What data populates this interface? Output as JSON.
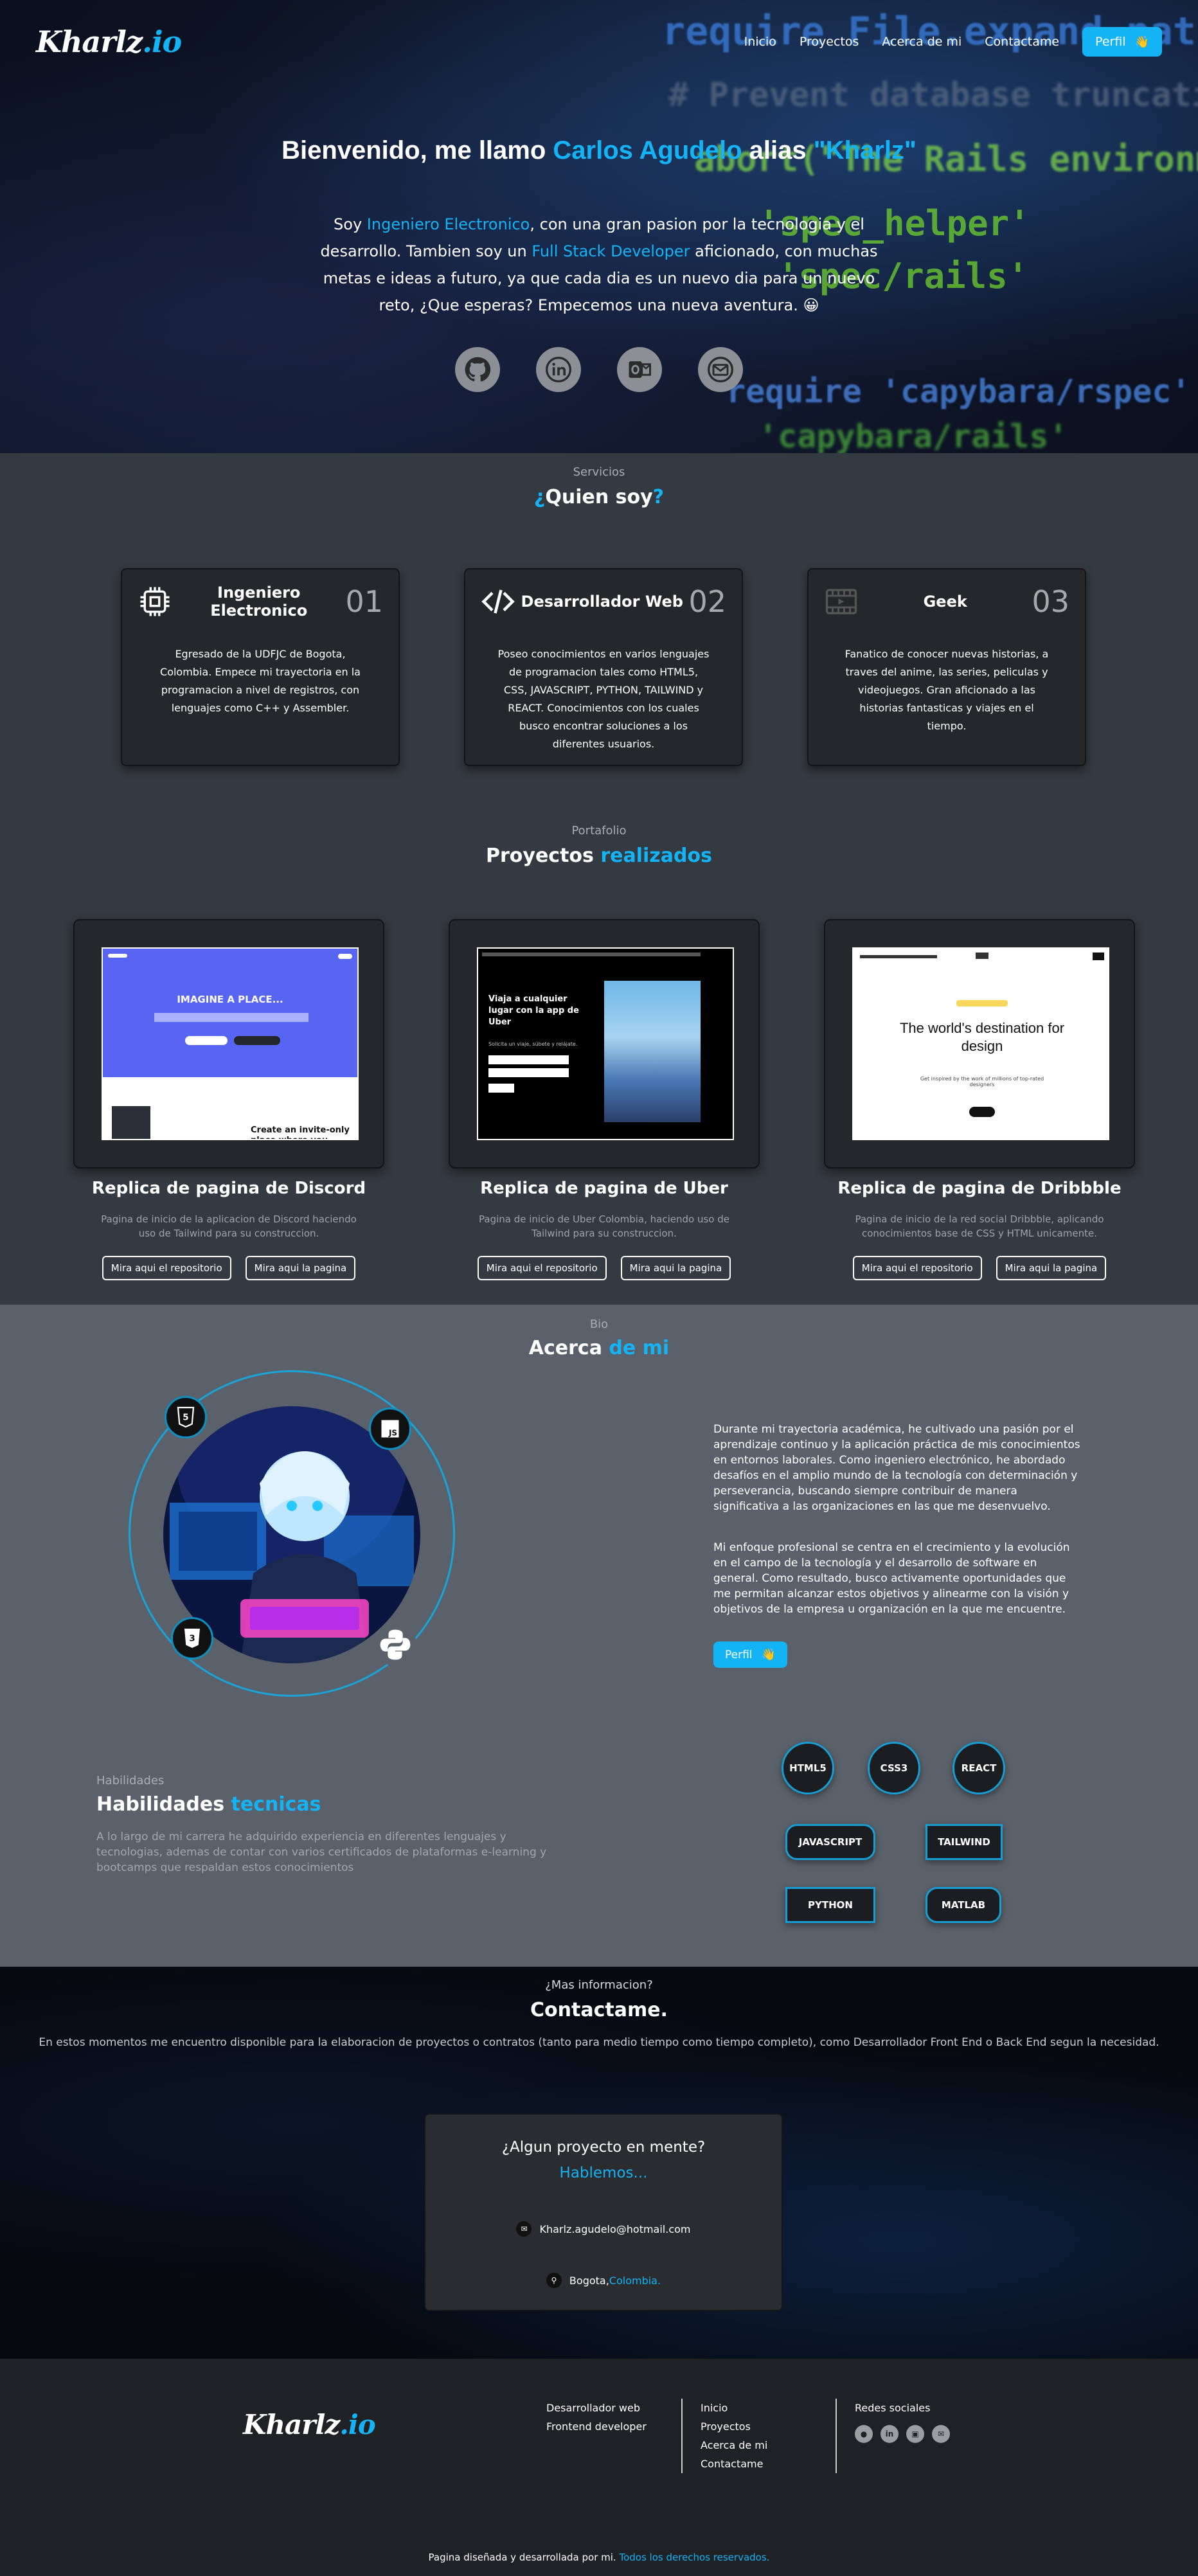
{
  "nav": {
    "logo_main": "Kharlz",
    "logo_ext": ".io",
    "links": [
      "Inicio",
      "Proyectos",
      "Acerca de mi",
      "Contactame"
    ],
    "profile_button": "Perfil",
    "profile_icon": "hand-wave-icon"
  },
  "hero": {
    "title_pre": "Bienvenido, me llamo ",
    "title_name": "Carlos Agudelo",
    "title_mid": " alias ",
    "title_alias": "\"Kharlz\"",
    "p_1": "Soy ",
    "p_role1": "Ingeniero Electronico",
    "p_2": ", con una gran pasion por la tecnologia y el desarrollo. Tambien soy un ",
    "p_role2": "Full Stack Developer",
    "p_3": " aficionado, con muchas metas e ideas a futuro, ya que cada dia es un nuevo dia para un nuevo reto, ¿Que esperas? Empecemos una nueva aventura. ",
    "p_emoji": "😀",
    "socials": [
      "github-icon",
      "linkedin-icon",
      "outlook-icon",
      "gmail-icon"
    ]
  },
  "services": {
    "kicker": "Servicios",
    "title_pre": "¿",
    "title_main": "Quien soy",
    "title_post": "?",
    "cards": [
      {
        "icon": "chip-icon",
        "name": "Ingeniero Electronico",
        "num": "01",
        "desc": "Egresado de la UDFJC de Bogota, Colombia. Empece mi trayectoria en la programacion a nivel de registros, con lenguajes como C++ y Assembler."
      },
      {
        "icon": "code-icon",
        "name": "Desarrollador Web",
        "num": "02",
        "desc": "Poseo conocimientos en varios lenguajes de programacion tales como HTML5, CSS, JAVASCRIPT, PYTHON, TAILWIND y REACT. Conocimientos con los cuales busco encontrar soluciones a los diferentes usuarios."
      },
      {
        "icon": "film-icon",
        "name": "Geek",
        "num": "03",
        "desc": "Fanatico de conocer nuevas historias, a traves del anime, las series, peliculas y videojuegos. Gran aficionado a las historias fantasticas y viajes en el tiempo."
      }
    ]
  },
  "projects": {
    "kicker": "Portafolio",
    "title_main": "Proyectos ",
    "title_accent": "realizados",
    "items": [
      {
        "title": "Replica de pagina de Discord",
        "desc": "Pagina de inicio de la aplicacion de Discord haciendo uso de Tailwind para su construccion.",
        "repo": "Mira aqui el repositorio",
        "page": "Mira aqui la pagina",
        "shot_headline": "IMAGINE A PLACE...",
        "shot_sub": "Create an invite-only place where you belong"
      },
      {
        "title": "Replica de pagina de Uber",
        "desc": "Pagina de inicio de Uber Colombia, haciendo uso de Tailwind para su construccion.",
        "repo": "Mira aqui el repositorio",
        "page": "Mira aqui la pagina",
        "shot_headline": "Viaja a cualquier lugar con la app de Uber",
        "shot_sub": "Solicita un viaje, súbete y relájate."
      },
      {
        "title": "Replica de pagina de Dribbble",
        "desc": "Pagina de inicio de la red social Dribbble, aplicando conocimientos base de CSS y HTML unicamente.",
        "repo": "Mira aqui el repositorio",
        "page": "Mira aqui la pagina",
        "shot_headline": "The world's destination for design",
        "shot_sub": "Get inspired by the work of millions of top-rated designers"
      }
    ]
  },
  "about": {
    "kicker": "Bio",
    "title_main": "Acerca ",
    "title_accent": "de mi",
    "p1": "Durante mi trayectoria académica, he cultivado una pasión por el aprendizaje continuo y la aplicación práctica de mis conocimientos en entornos laborales. Como ingeniero electrónico, he abordado desafíos en el amplio mundo de la tecnología con determinación y perseverancia, buscando siempre contribuir de manera significativa a las organizaciones en las que me desenvuelvo.",
    "p2": "Mi enfoque profesional se centra en el crecimiento y la evolución en el campo de la tecnología y el desarrollo de software en general. Como resultado, busco activamente oportunidades que me permitan alcanzar estos objetivos y alinearme con la visión y objetivos de la empresa u organización en la que me encuentre.",
    "profile_button": "Perfil",
    "badges": [
      "html5-icon",
      "js-icon",
      "css3-icon",
      "python-icon"
    ]
  },
  "skills": {
    "kicker": "Habilidades",
    "title_main": "Habilidades ",
    "title_accent": "tecnicas",
    "desc": "A lo largo de mi carrera he adquirido experiencia en diferentes lenguajes y tecnologias, ademas de contar con varios certificados de plataformas e-learning y bootcamps que respaldan estos conocimientos",
    "items": [
      "HTML5",
      "CSS3",
      "REACT",
      "JAVASCRIPT",
      "TAILWIND",
      "PYTHON",
      "MATLAB"
    ]
  },
  "contact": {
    "kicker": "¿Mas informacion?",
    "title": "Contactame.",
    "desc": "En estos momentos me encuentro disponible para la elaboracion de proyectos o contratos (tanto para medio tiempo como tiempo completo), como Desarrollador Front End o Back End segun la necesidad.",
    "card_q": "¿Algun proyecto en mente?",
    "card_cta": "Hablemos...",
    "email": "Kharlz.agudelo@hotmail.com",
    "city": "Bogota,",
    "country": "Colombia."
  },
  "footer": {
    "roles": [
      "Desarrollador web",
      "Frontend developer"
    ],
    "links": [
      "Inicio",
      "Proyectos",
      "Acerca de mi",
      "Contactame"
    ],
    "social_title": "Redes sociales",
    "socials": [
      "github-icon",
      "linkedin-icon",
      "outlook-icon",
      "gmail-icon"
    ],
    "copy_pre": "Pagina diseñada y desarrollada por mi. ",
    "copy_accent": "Todos los derechos reservados."
  },
  "colors": {
    "accent": "#14b3f5",
    "hero_bg": "#0b1020",
    "services_bg": "#343a41",
    "about_bg": "#5b616a",
    "contact_bg": "#06090f",
    "footer_bg": "#202124",
    "card_bg": "#25272b"
  }
}
